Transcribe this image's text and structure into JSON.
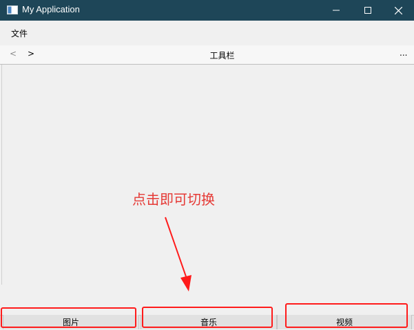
{
  "window": {
    "title": "My Application",
    "icon": "app-icon",
    "controls": [
      "minimize-icon",
      "maximize-icon",
      "close-icon"
    ]
  },
  "menu": {
    "items": [
      {
        "label": "文件"
      }
    ]
  },
  "toolbar": {
    "prev_label": "<",
    "next_label": ">",
    "title": "工具栏",
    "more_label": "..."
  },
  "annotation": {
    "text": "点击即可切换",
    "color": "#e53935"
  },
  "tabs": [
    {
      "label": "图片"
    },
    {
      "label": "音乐"
    },
    {
      "label": "视频"
    }
  ],
  "colors": {
    "titlebar": "#1e4658",
    "highlight": "#ff1a1a"
  }
}
